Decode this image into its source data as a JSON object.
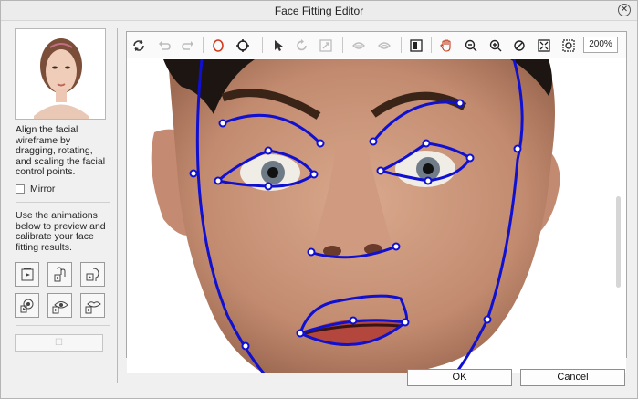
{
  "window": {
    "title": "Face Fitting Editor"
  },
  "left_panel": {
    "instructions": "Align the facial wireframe by dragging, rotating, and scaling the facial control points.",
    "mirror_label": "Mirror",
    "animation_instructions": "Use the animations below to preview and calibrate your face fitting results."
  },
  "toolbar": {
    "tools": [
      "rotate-icon",
      "undo-icon",
      "redo-icon",
      "face-outline-icon",
      "target-icon",
      "pointer-icon",
      "reset-icon",
      "scale-icon",
      "mouth-open-icon",
      "mouth-close-icon",
      "compare-icon",
      "hand-icon",
      "zoom-out-icon",
      "zoom-in-icon",
      "zoom-reset-icon",
      "fit-icon",
      "actual-size-icon"
    ],
    "zoom_value": "200%"
  },
  "buttons": {
    "ok": "OK",
    "cancel": "Cancel"
  },
  "colors": {
    "wireframe": "#1010d0",
    "skin": "#c6947a",
    "hair": "#1c1511"
  }
}
